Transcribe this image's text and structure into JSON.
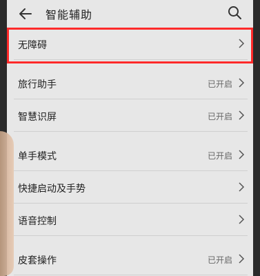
{
  "header": {
    "title": "智能辅助"
  },
  "items": [
    {
      "label": "无障碍",
      "status": ""
    },
    {
      "label": "旅行助手",
      "status": "已开启"
    },
    {
      "label": "智慧识屏",
      "status": "已开启"
    },
    {
      "label": "单手模式",
      "status": "已开启"
    },
    {
      "label": "快捷启动及手势",
      "status": ""
    },
    {
      "label": "语音控制",
      "status": ""
    },
    {
      "label": "皮套操作",
      "status": "已开启"
    }
  ],
  "colors": {
    "background": "#e7e7e7",
    "highlight": "#ff2a2a"
  },
  "icons": [
    "back-arrow-icon",
    "search-icon",
    "chevron-right-icon"
  ]
}
